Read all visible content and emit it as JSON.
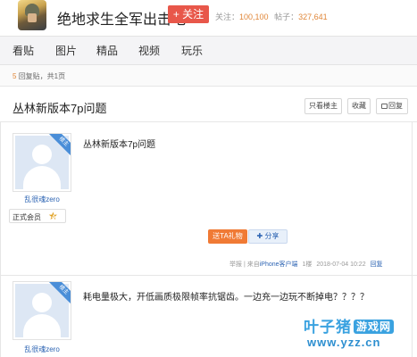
{
  "header": {
    "title": "绝地求生全军出击吧",
    "follow_label": "+ 关注",
    "follow_prefix": "关注：",
    "follow_count": "100,100",
    "posts_prefix": "帖子：",
    "posts_count": "327,641"
  },
  "nav": {
    "items": [
      {
        "label": "看贴"
      },
      {
        "label": "图片"
      },
      {
        "label": "精品"
      },
      {
        "label": "视频"
      },
      {
        "label": "玩乐"
      }
    ]
  },
  "pager": {
    "count": "5",
    "text": "回复贴，共1页"
  },
  "thread": {
    "title": "丛林新版本7p问题",
    "buttons": {
      "only_op": "只看楼主",
      "favorite": "收藏",
      "reply": "回复"
    }
  },
  "posts": [
    {
      "badge": "楼主",
      "author": "乱很魂zero",
      "member_label": "正式会员",
      "level": "4",
      "content": "丛林新版本7p问题",
      "gift_label": "送TA礼物",
      "share_label": "分享",
      "report": "举报",
      "source_prefix": "| 来自",
      "source_client": "iPhone客户端",
      "floor": "1楼",
      "time": "2018-07-04 10:22",
      "reply": "回复"
    },
    {
      "badge": "楼主",
      "author": "乱很魂zero",
      "content": "耗电量极大，开低画质极限帧率抗锯齿。一边充一边玩不断掉电？？？？"
    }
  ],
  "watermark": {
    "brand": "叶子猪",
    "tag": "游戏网",
    "url": "www.yzz.cn"
  },
  "colors": {
    "follow": "#e8574a",
    "accent_orange": "#e0873a",
    "link_blue": "#2d64b3",
    "badge_blue": "#4a8ed8"
  }
}
